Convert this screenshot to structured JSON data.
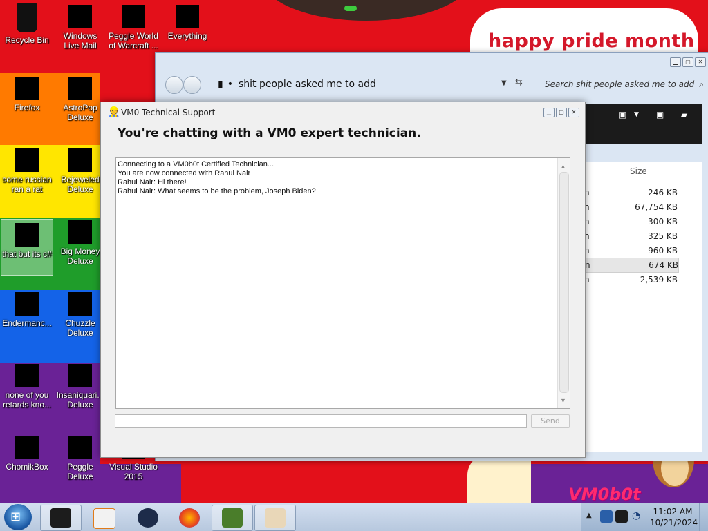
{
  "desktop": {
    "banner_text": "happy pride month",
    "logo_text": "VM0b0t",
    "icons": [
      {
        "label": "Recycle Bin"
      },
      {
        "label": "Windows Live Mail"
      },
      {
        "label": "Peggle World of Warcraft ..."
      },
      {
        "label": "Everything"
      },
      {
        "label": "Firefox"
      },
      {
        "label": "AstroPop Deluxe"
      },
      {
        "label": "some russian ran a rat"
      },
      {
        "label": "Bejeweled Deluxe"
      },
      {
        "label": "that but its c#"
      },
      {
        "label": "Big Money Deluxe"
      },
      {
        "label": "Endermanc..."
      },
      {
        "label": "Chuzzle Deluxe"
      },
      {
        "label": "none of you retards kno..."
      },
      {
        "label": "Insaniquari... Deluxe"
      },
      {
        "label": "ChomikBox"
      },
      {
        "label": "Peggle Deluxe"
      },
      {
        "label": "Visual Studio 2015"
      }
    ]
  },
  "explorer": {
    "path_bullet": "•",
    "folder_name": "shit people asked me to add",
    "search_placeholder": "Search shit people asked me to add",
    "size_header": "Size",
    "rows": [
      {
        "name": "n",
        "size": "246 KB"
      },
      {
        "name": "n",
        "size": "67,754 KB"
      },
      {
        "name": "n",
        "size": "300 KB"
      },
      {
        "name": "n",
        "size": "325 KB"
      },
      {
        "name": "n",
        "size": "960 KB"
      },
      {
        "name": "n",
        "size": "674 KB"
      },
      {
        "name": "n",
        "size": "2,539 KB"
      }
    ]
  },
  "chat": {
    "window_title": "VM0 Technical Support",
    "heading": "You're chatting with a VM0 expert technician.",
    "messages": [
      "Connecting to a VM0b0t Certified Technician...",
      "You are now connected with Rahul Nair",
      "Rahul Nair: Hi there!",
      "Rahul Nair: What seems to be the problem, Joseph Biden?"
    ],
    "input_value": "",
    "send_label": "Send"
  },
  "taskbar": {
    "clock_time": "11:02 AM",
    "clock_date": "10/21/2024"
  },
  "colors": {
    "banner_text": "#d4182a",
    "stripe_red": "#e3101a",
    "stripe_orange": "#ff7a00",
    "stripe_yellow": "#ffe600",
    "stripe_green": "#1f9d2a",
    "stripe_blue": "#1463e8",
    "stripe_purple": "#6a2296"
  }
}
